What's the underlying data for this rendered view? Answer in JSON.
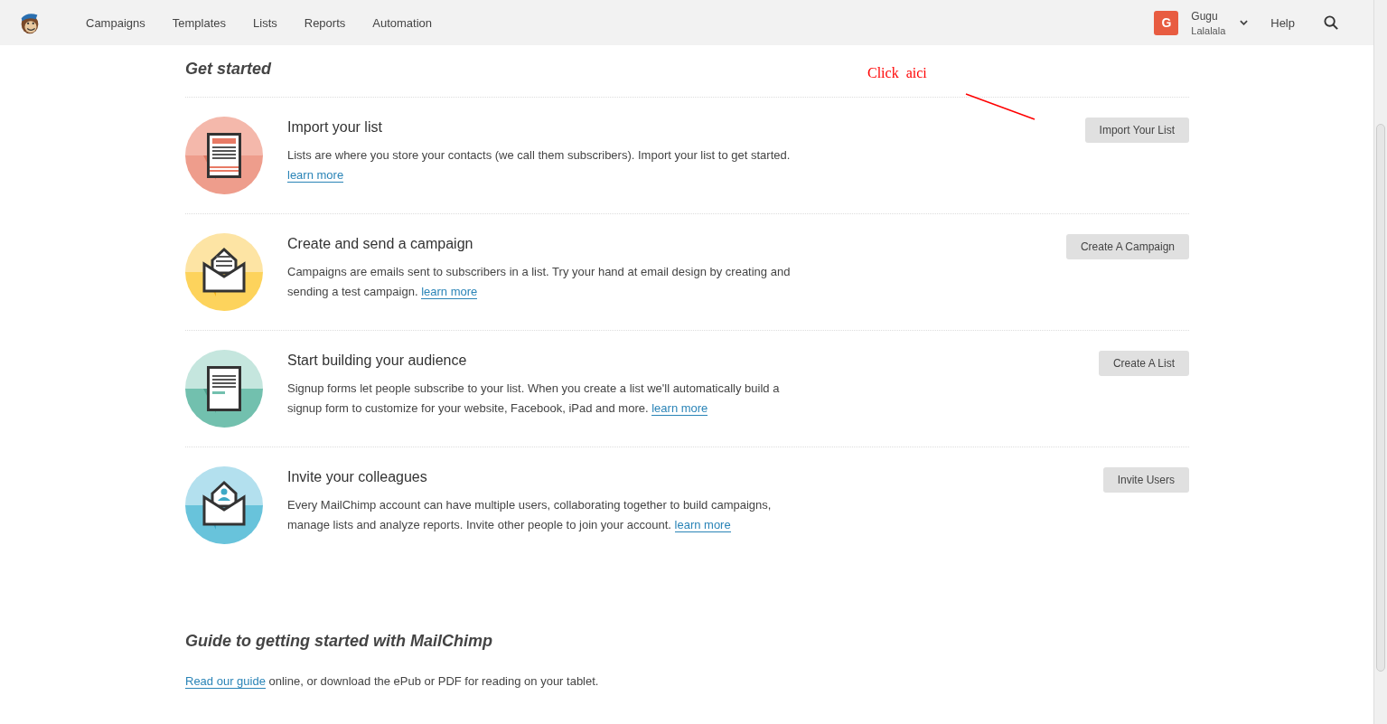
{
  "nav": {
    "items": [
      "Campaigns",
      "Templates",
      "Lists",
      "Reports",
      "Automation"
    ],
    "avatar_letter": "G",
    "user_name": "Gugu",
    "user_org": "Lalalala",
    "help": "Help"
  },
  "get_started": {
    "title": "Get started",
    "steps": [
      {
        "kind": "list",
        "title": "Import your list",
        "text": "Lists are where you store your contacts (we call them subscribers). Import your list to get started.",
        "link": "learn more",
        "button": "Import Your List"
      },
      {
        "kind": "campaign",
        "title": "Create and send a campaign",
        "text": "Campaigns are emails sent to subscribers in a list. Try your hand at email design by creating and sending a test campaign.",
        "link": "learn more",
        "button": "Create A Campaign"
      },
      {
        "kind": "audience",
        "title": "Start building your audience",
        "text": "Signup forms let people subscribe to your list. When you create a list we'll automatically build a signup form to customize for your website, Facebook, iPad and more.",
        "link": "learn more",
        "button": "Create A List"
      },
      {
        "kind": "colleagues",
        "title": "Invite your colleagues",
        "text": "Every MailChimp account can have multiple users, collaborating together to build campaigns, manage lists and analyze reports. Invite other people to join your account.",
        "link": "learn more",
        "button": "Invite Users"
      }
    ]
  },
  "annotation": {
    "text": "Click  aici"
  },
  "guide": {
    "title": "Guide to getting started with MailChimp",
    "link": "Read our guide",
    "text": "online, or download the ePub or PDF for reading on your tablet."
  }
}
